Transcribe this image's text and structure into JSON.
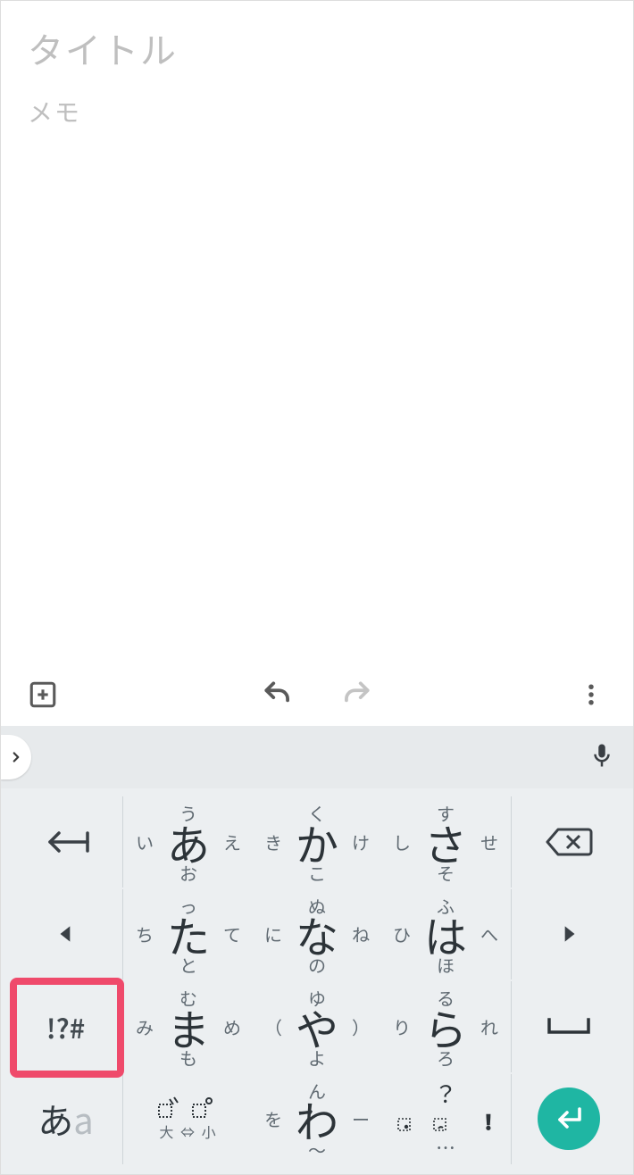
{
  "editor": {
    "title_placeholder": "タイトル",
    "body_placeholder": "メモ"
  },
  "appbar": {
    "add": "add-box",
    "undo": "undo",
    "redo": "redo",
    "more": "more-vert"
  },
  "suggestion_strip": {
    "expand": "chevron-right",
    "mic": "mic"
  },
  "keyboard": {
    "left_col": [
      "reverse-tab",
      "cursor-left",
      "!?#",
      "mode あa"
    ],
    "right_col": [
      "backspace",
      "cursor-right",
      "space",
      "enter"
    ],
    "symbol_key_label": "!?#",
    "mode_key": {
      "active": "あ",
      "inactive": "a"
    },
    "rows": [
      [
        {
          "c": "あ",
          "u": "う",
          "d": "お",
          "l": "い",
          "r": "え"
        },
        {
          "c": "か",
          "u": "く",
          "d": "こ",
          "l": "き",
          "r": "け"
        },
        {
          "c": "さ",
          "u": "す",
          "d": "そ",
          "l": "し",
          "r": "せ"
        }
      ],
      [
        {
          "c": "た",
          "u": "っ",
          "d": "と",
          "l": "ち",
          "r": "て"
        },
        {
          "c": "な",
          "u": "ぬ",
          "d": "の",
          "l": "に",
          "r": "ね"
        },
        {
          "c": "は",
          "u": "ふ",
          "d": "ほ",
          "l": "ひ",
          "r": "へ"
        }
      ],
      [
        {
          "c": "ま",
          "u": "む",
          "d": "も",
          "l": "み",
          "r": "め"
        },
        {
          "c": "や",
          "u": "ゆ",
          "d": "よ",
          "l": "（",
          "r": "）"
        },
        {
          "c": "ら",
          "u": "る",
          "d": "ろ",
          "l": "り",
          "r": "れ"
        }
      ],
      [
        {
          "type": "dakuten",
          "top": "゛ ゜",
          "bottom": "大 ⇔ 小"
        },
        {
          "c": "わ",
          "u": "ん",
          "d": "〜",
          "l": "を",
          "r": "ー"
        },
        {
          "type": "punct",
          "u": "？",
          "row": "。 、 ！",
          "d": "…"
        }
      ]
    ]
  },
  "highlight_target": "symbol-key"
}
